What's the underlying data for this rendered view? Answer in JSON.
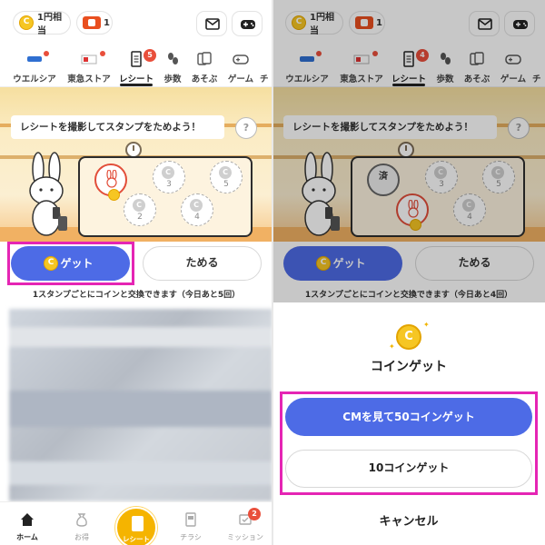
{
  "colors": {
    "accent": "#4d6be6",
    "highlight": "#e525b4",
    "coin": "#f6c623",
    "badge": "#e94f3b",
    "fab": "#f5b400"
  },
  "header": {
    "coin_label": "1円相当",
    "ticket_count": "1",
    "mail_icon": "mail-icon",
    "game_icon": "gamepad-icon"
  },
  "tabs": [
    {
      "label": "ウエルシア",
      "icon": "welcia-logo-icon"
    },
    {
      "label": "東急ストア",
      "icon": "tokyu-store-logo-icon"
    },
    {
      "label": "レシート",
      "icon": "receipt-icon"
    },
    {
      "label": "歩数",
      "icon": "steps-icon"
    },
    {
      "label": "あそぶ",
      "icon": "cards-icon"
    },
    {
      "label": "ゲーム",
      "icon": "gamepad-icon"
    },
    {
      "label": "チ",
      "icon": "chirashi-icon"
    }
  ],
  "left": {
    "receipt_tab_badge": "5",
    "prompt": "レシートを撮影してスタンプをためよう！",
    "help": "?",
    "stamps": [
      "",
      "2",
      "3",
      "4",
      "5"
    ],
    "get_button": "ゲット",
    "save_button": "ためる",
    "note": "1スタンプごとにコインと交換できます（今日あと5回）"
  },
  "right": {
    "receipt_tab_badge": "4",
    "prompt": "レシートを撮影してスタンプをためよう！",
    "help": "?",
    "used_stamp": "済",
    "stamps": [
      "",
      "",
      "3",
      "4",
      "5"
    ],
    "get_button": "ゲット",
    "save_button": "ためる",
    "note": "1スタンプごとにコインと交換できます（今日あと4回）"
  },
  "sheet": {
    "title": "コインゲット",
    "cm_button": "CMを見て50コインゲット",
    "ten_button": "10コインゲット",
    "cancel": "キャンセル"
  },
  "bottom_nav": {
    "home": "ホーム",
    "deals": "お得",
    "receipt": "レシート",
    "flyers": "チラシ",
    "missions": "ミッション",
    "missions_badge": "2"
  }
}
